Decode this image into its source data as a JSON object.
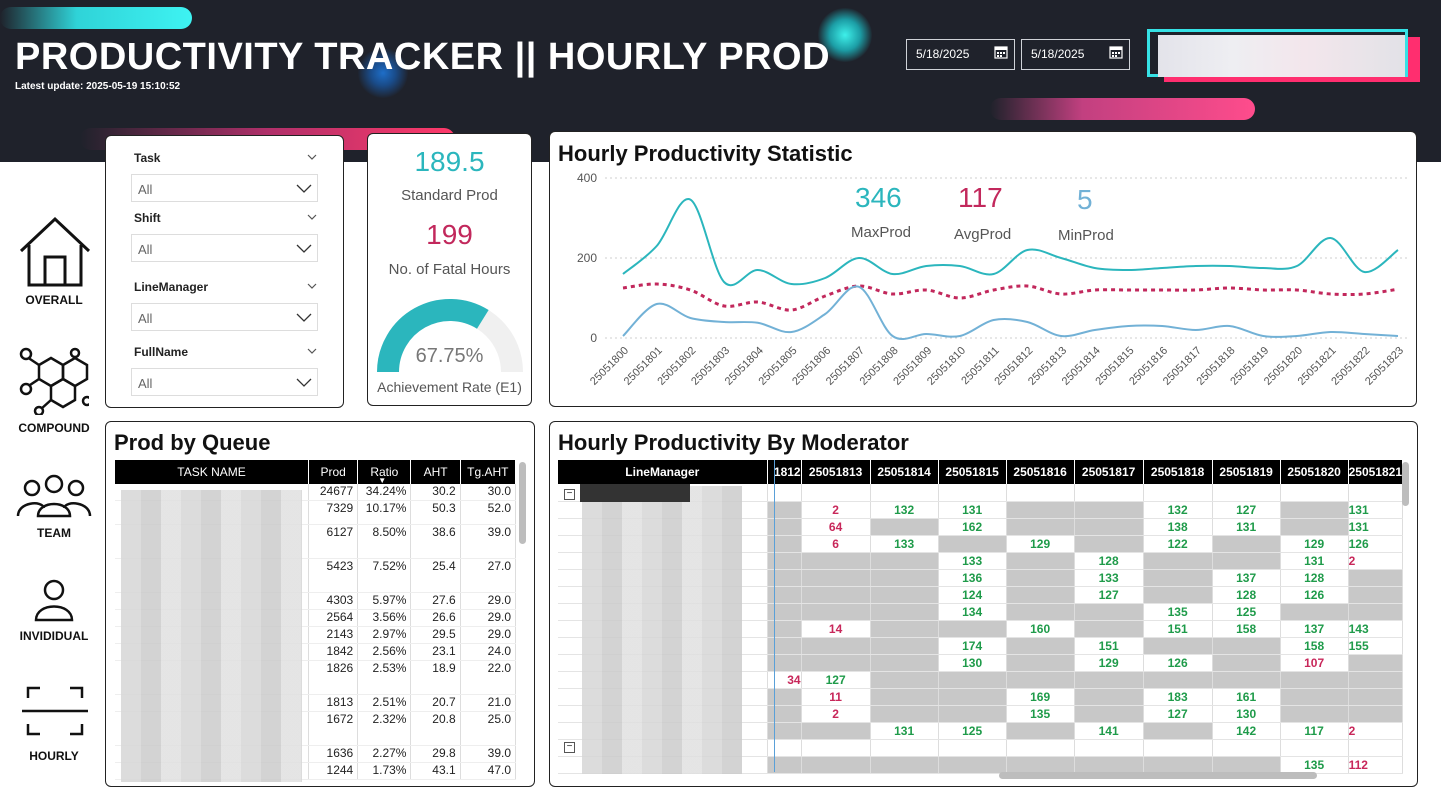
{
  "header": {
    "title": "PRODUCTIVITY TRACKER || HOURLY PROD",
    "last_update": "Latest update: 2025-05-19 15:10:52",
    "date_from": "5/18/2025",
    "date_to": "5/18/2025"
  },
  "nav": [
    {
      "label": "OVERALL",
      "icon": "home-icon"
    },
    {
      "label": "COMPOUND",
      "icon": "molecule-icon"
    },
    {
      "label": "TEAM",
      "icon": "team-icon"
    },
    {
      "label": "INVIDIDUAL",
      "icon": "person-icon"
    },
    {
      "label": "HOURLY",
      "icon": "focus-frame-icon"
    }
  ],
  "slicers": [
    {
      "label": "Task",
      "value": "All"
    },
    {
      "label": "Shift",
      "value": "All"
    },
    {
      "label": "LineManager",
      "value": "All"
    },
    {
      "label": "FullName",
      "value": "All"
    }
  ],
  "kpis": {
    "standard_prod": "189.5",
    "standard_prod_label": "Standard Prod",
    "fatal_hours": "199",
    "fatal_hours_label": "No. of Fatal Hours",
    "achievement": "67.75%",
    "achievement_fraction": 0.6775,
    "achievement_label": "Achievement Rate (E1)"
  },
  "colors": {
    "teal": "#2bb6bd",
    "magenta": "#c2285c",
    "lightblue": "#72b1d6",
    "gauge_bg": "#f0f0f0"
  },
  "hourly_chart": {
    "title": "Hourly Productivity Statistic",
    "max_value": "346",
    "max_label": "MaxProd",
    "avg_value": "117",
    "avg_label": "AvgProd",
    "min_value": "5",
    "min_label": "MinProd"
  },
  "chart_data": {
    "type": "line",
    "categories": [
      "25051800",
      "25051801",
      "25051802",
      "25051803",
      "25051804",
      "25051805",
      "25051806",
      "25051807",
      "25051808",
      "25051809",
      "25051810",
      "25051811",
      "25051812",
      "25051813",
      "25051814",
      "25051815",
      "25051816",
      "25051817",
      "25051818",
      "25051819",
      "25051820",
      "25051821",
      "25051822",
      "25051823"
    ],
    "yticks": [
      0,
      200,
      400
    ],
    "ylim": [
      0,
      400
    ],
    "series": [
      {
        "name": "MaxProd",
        "color": "#2bb6bd",
        "dash": "",
        "values": [
          160,
          230,
          346,
          140,
          170,
          135,
          150,
          200,
          160,
          180,
          180,
          160,
          220,
          200,
          175,
          170,
          175,
          180,
          180,
          175,
          180,
          250,
          165,
          220
        ]
      },
      {
        "name": "AvgProd",
        "color": "#c2285c",
        "dash": "4 4",
        "values": [
          125,
          135,
          120,
          80,
          90,
          70,
          105,
          130,
          110,
          120,
          100,
          120,
          130,
          110,
          120,
          120,
          120,
          120,
          125,
          120,
          120,
          110,
          110,
          122
        ]
      },
      {
        "name": "MinProd",
        "color": "#72b1d6",
        "dash": "",
        "values": [
          5,
          85,
          50,
          40,
          38,
          15,
          60,
          128,
          5,
          10,
          5,
          45,
          40,
          5,
          20,
          30,
          30,
          20,
          30,
          5,
          5,
          15,
          10,
          5
        ]
      }
    ]
  },
  "queue_table": {
    "title": "Prod by Queue",
    "columns": [
      "TASK NAME",
      "Prod",
      "Ratio",
      "AHT",
      "Tg.AHT"
    ],
    "rows": [
      [
        "24677",
        "34.24%",
        "30.2",
        "30.0"
      ],
      [
        "7329",
        "10.17%",
        "50.3",
        "52.0"
      ],
      [
        "6127",
        "8.50%",
        "38.6",
        "39.0"
      ],
      [
        "5423",
        "7.52%",
        "25.4",
        "27.0"
      ],
      [
        "4303",
        "5.97%",
        "27.6",
        "29.0"
      ],
      [
        "2564",
        "3.56%",
        "26.6",
        "29.0"
      ],
      [
        "2143",
        "2.97%",
        "29.5",
        "29.0"
      ],
      [
        "1842",
        "2.56%",
        "23.1",
        "24.0"
      ],
      [
        "1826",
        "2.53%",
        "18.9",
        "22.0"
      ],
      [
        "1813",
        "2.51%",
        "20.7",
        "21.0"
      ],
      [
        "1672",
        "2.32%",
        "20.8",
        "25.0"
      ],
      [
        "1636",
        "2.27%",
        "29.8",
        "39.0"
      ],
      [
        "1244",
        "1.73%",
        "43.1",
        "47.0"
      ]
    ]
  },
  "moderator_table": {
    "title": "Hourly Productivity By Moderator",
    "first_col": "LineManager",
    "columns": [
      "1812",
      "25051813",
      "25051814",
      "25051815",
      "25051816",
      "25051817",
      "25051818",
      "25051819",
      "25051820",
      "25051821"
    ],
    "rows": [
      [
        "",
        "",
        "",
        "",
        "",
        "",
        "",
        "",
        "",
        ""
      ],
      [
        "",
        "2",
        "132",
        "131",
        "",
        "",
        "132",
        "127",
        "",
        "131"
      ],
      [
        "",
        "64",
        "",
        "162",
        "",
        "",
        "138",
        "131",
        "",
        "131"
      ],
      [
        "",
        "6",
        "133",
        "",
        "129",
        "",
        "122",
        "",
        "129",
        "126"
      ],
      [
        "",
        "",
        "",
        "133",
        "",
        "128",
        "",
        "",
        "131",
        "2"
      ],
      [
        "",
        "",
        "",
        "136",
        "",
        "133",
        "",
        "137",
        "128",
        ""
      ],
      [
        "",
        "",
        "",
        "124",
        "",
        "127",
        "",
        "128",
        "126",
        ""
      ],
      [
        "",
        "",
        "",
        "134",
        "",
        "",
        "135",
        "125",
        "",
        ""
      ],
      [
        "",
        "14",
        "",
        "",
        "160",
        "",
        "151",
        "158",
        "137",
        "143"
      ],
      [
        "",
        "",
        "",
        "174",
        "",
        "151",
        "",
        "",
        "158",
        "155"
      ],
      [
        "",
        "",
        "",
        "130",
        "",
        "129",
        "126",
        "",
        "107",
        ""
      ],
      [
        "34",
        "127",
        "",
        "",
        "",
        "",
        "",
        "",
        "",
        ""
      ],
      [
        "",
        "11",
        "",
        "",
        "169",
        "",
        "183",
        "161",
        "",
        ""
      ],
      [
        "",
        "2",
        "",
        "",
        "135",
        "",
        "127",
        "130",
        "",
        ""
      ],
      [
        "",
        "",
        "131",
        "125",
        "",
        "141",
        "",
        "142",
        "117",
        "2"
      ],
      [
        "",
        "",
        "",
        "",
        "",
        "",
        "",
        "",
        "",
        ""
      ],
      [
        "",
        "",
        "",
        "",
        "",
        "",
        "",
        "",
        "135",
        "112"
      ]
    ]
  }
}
